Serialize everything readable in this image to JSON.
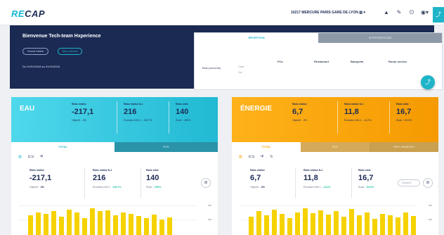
{
  "header": {
    "logo_re": "RE",
    "logo_cap": "CAP",
    "site": "10217 MERCURE PARIS GARE DE LYON",
    "site_icon": "building-icon",
    "icons": [
      "bell-icon",
      "pencil-icon",
      "power-icon",
      "user-icon"
    ]
  },
  "hero": {
    "title": "Bienvenue Tech-team Hxperience",
    "pill1": "Grand hôtels",
    "pill2": "Mon accueil",
    "period": "Du 01/01/2018 au 31/01/2018"
  },
  "reco": {
    "tab1": "RÉCEPTION",
    "tab2": "INTERVENTIONS",
    "cols": [
      "PCs",
      "Restaurant",
      "Banquets",
      "Room service"
    ],
    "row_label": "Total (couverts)",
    "sub1": "Cand",
    "sub2": "Cur"
  },
  "eau": {
    "title": "EAU",
    "kpis": [
      {
        "label": "Ratio réalisé",
        "value": "-217,1",
        "sub": "Objectif : -3%"
      },
      {
        "label": "Ratio réalisé N-1",
        "value": "216",
        "sub": "Évolution N/N-1 : -209,7%"
      },
      {
        "label": "Ratio cible",
        "value": "140",
        "sub": "Écart : -255%"
      }
    ],
    "tabs": [
      "TOTAL",
      "PCS"
    ],
    "kpis2": [
      {
        "label": "Ratio réalisé",
        "value": "-217,1",
        "sub_pre": "Objectif :",
        "sub_val": "-3%"
      },
      {
        "label": "Ratio réalisé N-1",
        "value": "216",
        "sub_pre": "Évolution N/N-1 :",
        "sub_val": "-209,7%"
      },
      {
        "label": "Ratio cible",
        "value": "140",
        "sub_pre": "Écart :",
        "sub_val": "-255%"
      }
    ],
    "axis_top": "300",
    "axis_mid": "200"
  },
  "energie": {
    "title": "ÉNERGIE",
    "kpis": [
      {
        "label": "Ratio réalisé",
        "value": "6,7",
        "sub": "Objectif : -3%"
      },
      {
        "label": "Ratio réalisé N-1",
        "value": "11,8",
        "sub": "Évolution N/N-1 : -43,2%"
      },
      {
        "label": "Ratio cible",
        "value": "16,7",
        "sub": "Écart : -59,8%"
      }
    ],
    "tabs": [
      "TOTAL",
      "PCS",
      "RES. ANNEXES"
    ],
    "kpis2": [
      {
        "label": "Ratio réalisé",
        "value": "6,7",
        "sub_pre": "Objectif :",
        "sub_val": "-3%"
      },
      {
        "label": "Ratio réalisé N-1",
        "value": "11,8",
        "sub_pre": "Évolution N/N-1 :",
        "sub_val": "-43,2%"
      },
      {
        "label": "Ratio cible",
        "value": "16,7",
        "sub_pre": "Écart :",
        "sub_val": "-59,8%"
      }
    ],
    "select": "Choisir",
    "axis_top": "300",
    "axis_mid": "200"
  },
  "chart_data": [
    {
      "type": "bar",
      "values": [
        70,
        80,
        75,
        85,
        65,
        90,
        80,
        60,
        95,
        85,
        88,
        70,
        80,
        75,
        68,
        60,
        72,
        55,
        62
      ],
      "color": "#f5d200"
    },
    {
      "type": "bar",
      "values": [
        65,
        85,
        70,
        90,
        75,
        60,
        80,
        95,
        78,
        88,
        72,
        84,
        66,
        92,
        70,
        80,
        58,
        75,
        70,
        62,
        80,
        68
      ],
      "color": "#f5d200"
    }
  ],
  "colors": {
    "eau": "#21b9d3",
    "energie": "#f59a00",
    "navy": "#1b2a53"
  }
}
